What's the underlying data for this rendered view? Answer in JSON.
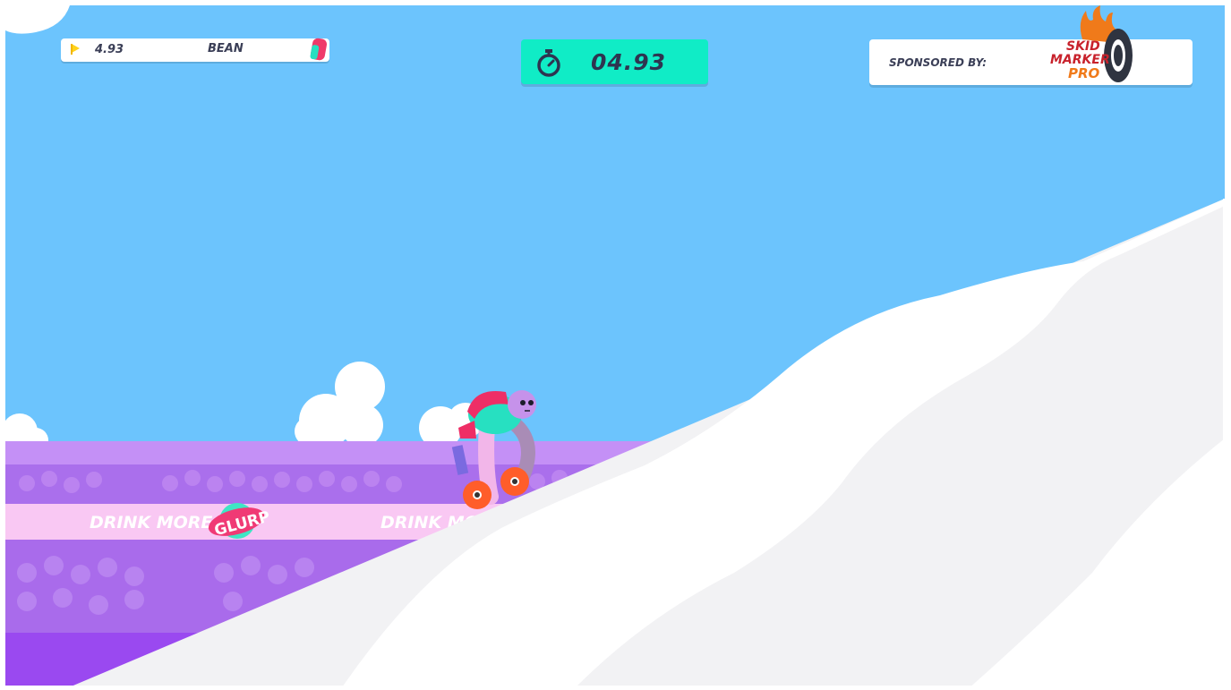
{
  "hud": {
    "leaderboard": {
      "time": "4.93",
      "name": "BEAN"
    },
    "timer": {
      "value": "04.93",
      "icon": "stopwatch-icon"
    },
    "sponsor": {
      "label": "SPONSORED BY:",
      "logo": {
        "line1": "SKID",
        "line2": "MARKER",
        "line3": "PRO"
      }
    }
  },
  "scene": {
    "banner_text": "DRINK MORE",
    "banner_text_cut": "DRINK MO",
    "brand": "GLURP",
    "character": "rider-character"
  },
  "colors": {
    "sky": "#6cc4fd",
    "snow": "#f2f2f4",
    "stands": "#b77ef2",
    "banner": "#f9c8f3",
    "timer_bg": "#10ecc6",
    "text_dark": "#3b3f57",
    "logo_red": "#c8222c",
    "logo_orange": "#f07a1a"
  }
}
